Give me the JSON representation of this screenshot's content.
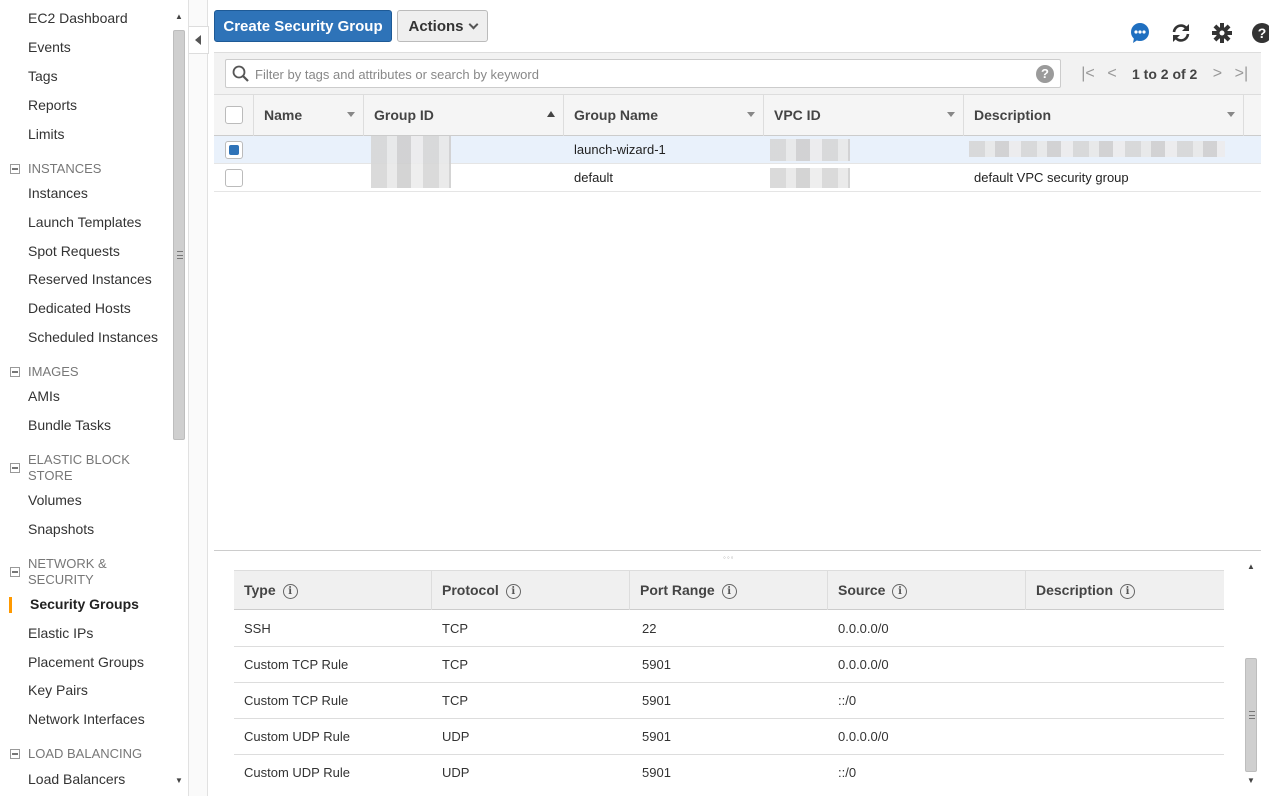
{
  "sidebar": {
    "top_items": [
      "EC2 Dashboard",
      "Events",
      "Tags",
      "Reports",
      "Limits"
    ],
    "sections": {
      "instances": {
        "title": "INSTANCES",
        "items": [
          "Instances",
          "Launch Templates",
          "Spot Requests",
          "Reserved Instances",
          "Dedicated Hosts",
          "Scheduled Instances"
        ]
      },
      "images": {
        "title": "IMAGES",
        "items": [
          "AMIs",
          "Bundle Tasks"
        ]
      },
      "ebs": {
        "title": "ELASTIC BLOCK STORE",
        "items": [
          "Volumes",
          "Snapshots"
        ]
      },
      "network": {
        "title": "NETWORK & SECURITY",
        "items": [
          "Security Groups",
          "Elastic IPs",
          "Placement Groups",
          "Key Pairs",
          "Network Interfaces"
        ]
      },
      "lb": {
        "title": "LOAD BALANCING",
        "items": [
          "Load Balancers"
        ]
      }
    },
    "active_item": "Security Groups"
  },
  "toolbar": {
    "create_label": "Create Security Group",
    "actions_label": "Actions",
    "icons": [
      "chat-icon",
      "refresh-icon",
      "gear-icon",
      "help-icon"
    ]
  },
  "filter": {
    "placeholder": "Filter by tags and attributes or search by keyword",
    "pagination": "1 to 2 of 2"
  },
  "grid": {
    "columns": [
      "Name",
      "Group ID",
      "Group Name",
      "VPC ID",
      "Description"
    ],
    "rows": [
      {
        "name": "",
        "group_name": "launch-wizard-1",
        "description": "",
        "selected": true
      },
      {
        "name": "",
        "group_name": "default",
        "description": "default VPC security group",
        "selected": false
      }
    ]
  },
  "rules": {
    "columns": [
      "Type",
      "Protocol",
      "Port Range",
      "Source",
      "Description"
    ],
    "rows": [
      {
        "type": "SSH",
        "protocol": "TCP",
        "port": "22",
        "source": "0.0.0.0/0",
        "description": ""
      },
      {
        "type": "Custom TCP Rule",
        "protocol": "TCP",
        "port": "5901",
        "source": "0.0.0.0/0",
        "description": ""
      },
      {
        "type": "Custom TCP Rule",
        "protocol": "TCP",
        "port": "5901",
        "source": "::/0",
        "description": ""
      },
      {
        "type": "Custom UDP Rule",
        "protocol": "UDP",
        "port": "5901",
        "source": "0.0.0.0/0",
        "description": ""
      },
      {
        "type": "Custom UDP Rule",
        "protocol": "UDP",
        "port": "5901",
        "source": "::/0",
        "description": ""
      }
    ]
  },
  "colors": {
    "primary": "#2e73b8",
    "active_accent": "#ff9900",
    "chat_icon": "#1f6fc0"
  }
}
